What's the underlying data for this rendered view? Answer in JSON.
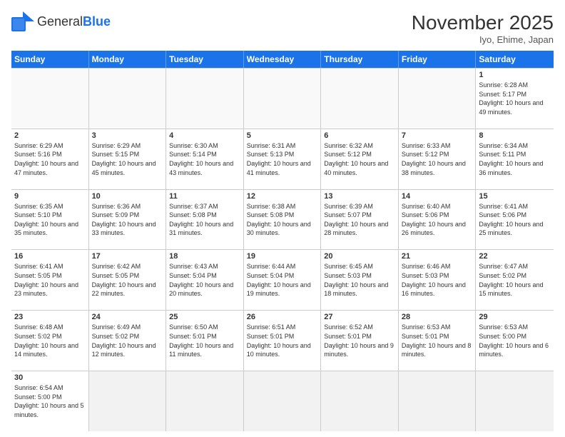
{
  "app": {
    "name_general": "General",
    "name_blue": "Blue"
  },
  "title": "November 2025",
  "subtitle": "Iyo, Ehime, Japan",
  "days": [
    "Sunday",
    "Monday",
    "Tuesday",
    "Wednesday",
    "Thursday",
    "Friday",
    "Saturday"
  ],
  "weeks": [
    [
      {
        "day": "",
        "info": ""
      },
      {
        "day": "",
        "info": ""
      },
      {
        "day": "",
        "info": ""
      },
      {
        "day": "",
        "info": ""
      },
      {
        "day": "",
        "info": ""
      },
      {
        "day": "",
        "info": ""
      },
      {
        "day": "1",
        "info": "Sunrise: 6:28 AM\nSunset: 5:17 PM\nDaylight: 10 hours and 49 minutes."
      }
    ],
    [
      {
        "day": "2",
        "info": "Sunrise: 6:29 AM\nSunset: 5:16 PM\nDaylight: 10 hours and 47 minutes."
      },
      {
        "day": "3",
        "info": "Sunrise: 6:29 AM\nSunset: 5:15 PM\nDaylight: 10 hours and 45 minutes."
      },
      {
        "day": "4",
        "info": "Sunrise: 6:30 AM\nSunset: 5:14 PM\nDaylight: 10 hours and 43 minutes."
      },
      {
        "day": "5",
        "info": "Sunrise: 6:31 AM\nSunset: 5:13 PM\nDaylight: 10 hours and 41 minutes."
      },
      {
        "day": "6",
        "info": "Sunrise: 6:32 AM\nSunset: 5:12 PM\nDaylight: 10 hours and 40 minutes."
      },
      {
        "day": "7",
        "info": "Sunrise: 6:33 AM\nSunset: 5:12 PM\nDaylight: 10 hours and 38 minutes."
      },
      {
        "day": "8",
        "info": "Sunrise: 6:34 AM\nSunset: 5:11 PM\nDaylight: 10 hours and 36 minutes."
      }
    ],
    [
      {
        "day": "9",
        "info": "Sunrise: 6:35 AM\nSunset: 5:10 PM\nDaylight: 10 hours and 35 minutes."
      },
      {
        "day": "10",
        "info": "Sunrise: 6:36 AM\nSunset: 5:09 PM\nDaylight: 10 hours and 33 minutes."
      },
      {
        "day": "11",
        "info": "Sunrise: 6:37 AM\nSunset: 5:08 PM\nDaylight: 10 hours and 31 minutes."
      },
      {
        "day": "12",
        "info": "Sunrise: 6:38 AM\nSunset: 5:08 PM\nDaylight: 10 hours and 30 minutes."
      },
      {
        "day": "13",
        "info": "Sunrise: 6:39 AM\nSunset: 5:07 PM\nDaylight: 10 hours and 28 minutes."
      },
      {
        "day": "14",
        "info": "Sunrise: 6:40 AM\nSunset: 5:06 PM\nDaylight: 10 hours and 26 minutes."
      },
      {
        "day": "15",
        "info": "Sunrise: 6:41 AM\nSunset: 5:06 PM\nDaylight: 10 hours and 25 minutes."
      }
    ],
    [
      {
        "day": "16",
        "info": "Sunrise: 6:41 AM\nSunset: 5:05 PM\nDaylight: 10 hours and 23 minutes."
      },
      {
        "day": "17",
        "info": "Sunrise: 6:42 AM\nSunset: 5:05 PM\nDaylight: 10 hours and 22 minutes."
      },
      {
        "day": "18",
        "info": "Sunrise: 6:43 AM\nSunset: 5:04 PM\nDaylight: 10 hours and 20 minutes."
      },
      {
        "day": "19",
        "info": "Sunrise: 6:44 AM\nSunset: 5:04 PM\nDaylight: 10 hours and 19 minutes."
      },
      {
        "day": "20",
        "info": "Sunrise: 6:45 AM\nSunset: 5:03 PM\nDaylight: 10 hours and 18 minutes."
      },
      {
        "day": "21",
        "info": "Sunrise: 6:46 AM\nSunset: 5:03 PM\nDaylight: 10 hours and 16 minutes."
      },
      {
        "day": "22",
        "info": "Sunrise: 6:47 AM\nSunset: 5:02 PM\nDaylight: 10 hours and 15 minutes."
      }
    ],
    [
      {
        "day": "23",
        "info": "Sunrise: 6:48 AM\nSunset: 5:02 PM\nDaylight: 10 hours and 14 minutes."
      },
      {
        "day": "24",
        "info": "Sunrise: 6:49 AM\nSunset: 5:02 PM\nDaylight: 10 hours and 12 minutes."
      },
      {
        "day": "25",
        "info": "Sunrise: 6:50 AM\nSunset: 5:01 PM\nDaylight: 10 hours and 11 minutes."
      },
      {
        "day": "26",
        "info": "Sunrise: 6:51 AM\nSunset: 5:01 PM\nDaylight: 10 hours and 10 minutes."
      },
      {
        "day": "27",
        "info": "Sunrise: 6:52 AM\nSunset: 5:01 PM\nDaylight: 10 hours and 9 minutes."
      },
      {
        "day": "28",
        "info": "Sunrise: 6:53 AM\nSunset: 5:01 PM\nDaylight: 10 hours and 8 minutes."
      },
      {
        "day": "29",
        "info": "Sunrise: 6:53 AM\nSunset: 5:00 PM\nDaylight: 10 hours and 6 minutes."
      }
    ],
    [
      {
        "day": "30",
        "info": "Sunrise: 6:54 AM\nSunset: 5:00 PM\nDaylight: 10 hours and 5 minutes."
      },
      {
        "day": "",
        "info": ""
      },
      {
        "day": "",
        "info": ""
      },
      {
        "day": "",
        "info": ""
      },
      {
        "day": "",
        "info": ""
      },
      {
        "day": "",
        "info": ""
      },
      {
        "day": "",
        "info": ""
      }
    ]
  ]
}
